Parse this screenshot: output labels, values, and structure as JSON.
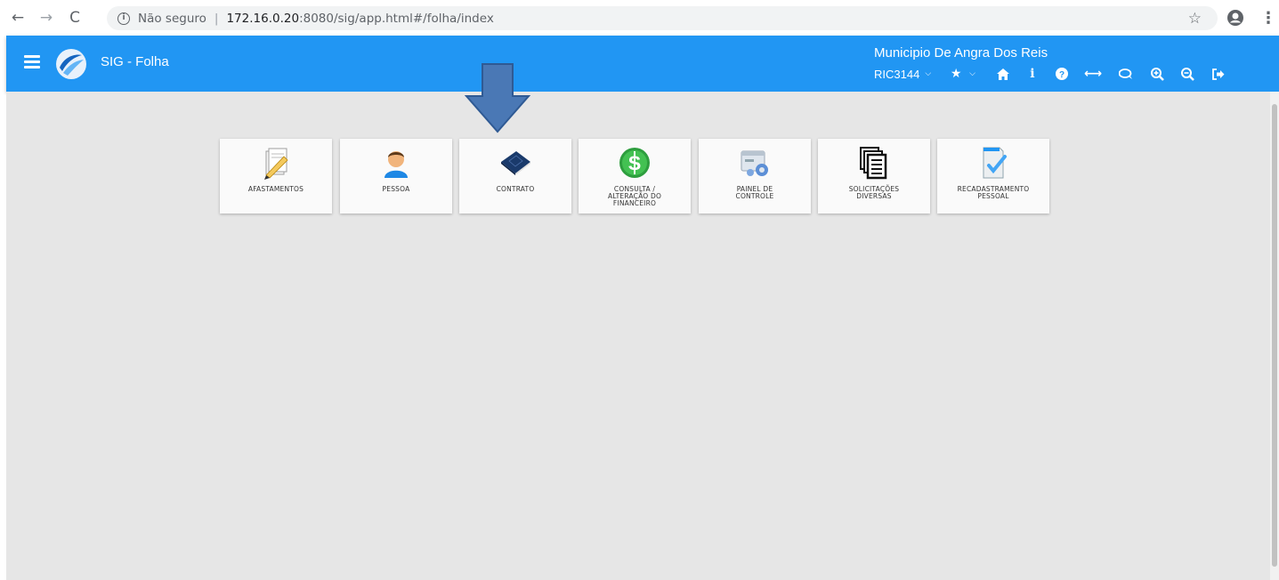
{
  "browser": {
    "back": "←",
    "forward": "→",
    "reload": "C",
    "security": "Não seguro",
    "url_host": "172.16.0.20",
    "url_rest": ":8080/sig/app.html#/folha/index",
    "star": "☆",
    "menu": "⋮"
  },
  "header": {
    "title": "SIG - Folha",
    "municipio": "Municipio De Angra Dos Reis",
    "user": "RIC3144"
  },
  "tiles": [
    {
      "label": "AFASTAMENTOS",
      "icon": "edit-document-icon"
    },
    {
      "label": "PESSOA",
      "icon": "person-icon"
    },
    {
      "label": "CONTRATO",
      "icon": "contract-book-icon"
    },
    {
      "label": "CONSULTA /\nALTERAÇÃO DO\nFINANCEIRO",
      "icon": "dollar-icon"
    },
    {
      "label": "PAINEL DE\nCONTROLE",
      "icon": "control-panel-icon"
    },
    {
      "label": "SOLICITAÇÕES\nDIVERSAS",
      "icon": "documents-stack-icon"
    },
    {
      "label": "RECADASTRAMENTO\nPESSOAL",
      "icon": "document-check-icon"
    }
  ],
  "colors": {
    "header": "#2196f3",
    "background": "#e6e6e6",
    "arrow": "#4a78b5"
  }
}
